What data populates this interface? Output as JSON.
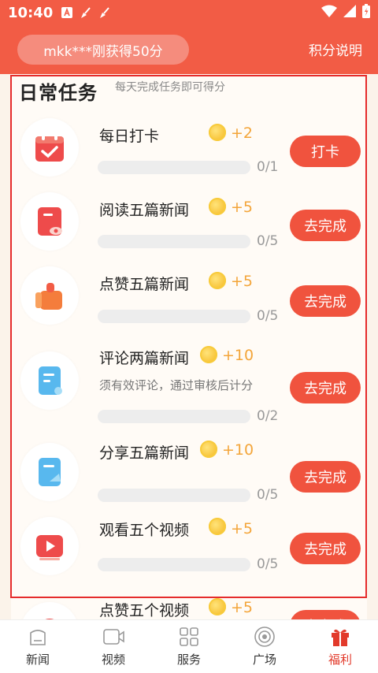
{
  "status_bar": {
    "time": "10:40"
  },
  "header": {
    "announcement": "mkk***刚获得50分",
    "rules_link": "积分说明"
  },
  "section": {
    "title": "日常任务",
    "subtitle": "每天完成任务即可得分"
  },
  "tasks": [
    {
      "name": "每日打卡",
      "points": "+2",
      "progress": "0/1",
      "progress_fraction": 0,
      "button": "打卡",
      "icon": "calendar-check-icon"
    },
    {
      "name": "阅读五篇新闻",
      "points": "+5",
      "progress": "0/5",
      "progress_fraction": 0,
      "button": "去完成",
      "icon": "read-news-icon"
    },
    {
      "name": "点赞五篇新闻",
      "points": "+5",
      "progress": "0/5",
      "progress_fraction": 0,
      "button": "去完成",
      "icon": "like-hand-icon"
    },
    {
      "name": "评论两篇新闻",
      "points": "+10",
      "desc": "须有效评论，通过审核后计分",
      "progress": "0/2",
      "progress_fraction": 0,
      "button": "去完成",
      "icon": "comment-doc-icon"
    },
    {
      "name": "分享五篇新闻",
      "points": "+10",
      "progress": "0/5",
      "progress_fraction": 0,
      "button": "去完成",
      "icon": "share-doc-icon"
    },
    {
      "name": "观看五个视频",
      "points": "+5",
      "progress": "0/5",
      "progress_fraction": 0,
      "button": "去完成",
      "icon": "video-play-icon"
    },
    {
      "name": "点赞五个视频",
      "points": "+5",
      "button": "去完成",
      "icon": "video-like-icon"
    }
  ],
  "tabs": [
    {
      "label": "新闻",
      "icon": "news-icon",
      "active": false
    },
    {
      "label": "视频",
      "icon": "video-icon",
      "active": false
    },
    {
      "label": "服务",
      "icon": "grid-icon",
      "active": false
    },
    {
      "label": "广场",
      "icon": "plaza-icon",
      "active": false
    },
    {
      "label": "福利",
      "icon": "gift-icon",
      "active": true
    }
  ],
  "colors": {
    "primary": "#F25C45",
    "button": "#F0533E",
    "points": "#F3A53A",
    "active_tab": "#E23A2B"
  }
}
